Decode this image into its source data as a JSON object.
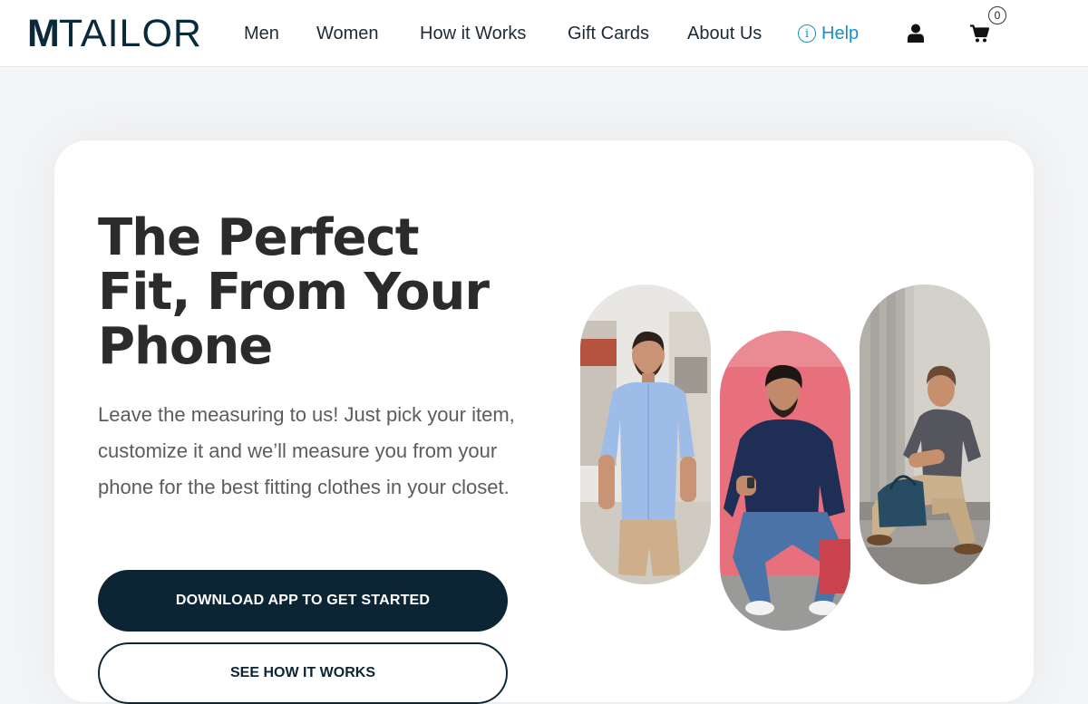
{
  "header": {
    "logo": {
      "m": "M",
      "rest": "TAILOR"
    },
    "nav": [
      {
        "label": "Men"
      },
      {
        "label": "Women"
      },
      {
        "label": "How it Works"
      },
      {
        "label": "Gift Cards"
      },
      {
        "label": "About Us"
      }
    ],
    "help": {
      "icon": "info-icon",
      "glyph": "i",
      "label": "Help"
    },
    "account_icon": "user-icon",
    "cart": {
      "icon": "cart-icon",
      "count": "0"
    }
  },
  "hero": {
    "headline": "The Perfect Fit, From Your Phone",
    "subtext": "Leave the measuring to us! Just pick your item, customize it and we’ll measure you from your phone for the best fitting clothes in your closet.",
    "primary_button": "DOWNLOAD APP TO GET STARTED",
    "secondary_button": "SEE HOW IT WORKS"
  },
  "colors": {
    "brand_navy": "#0b2535",
    "help_blue": "#1a8fc6",
    "headline": "#2b2b2b",
    "body_text": "#5c5c5c"
  }
}
